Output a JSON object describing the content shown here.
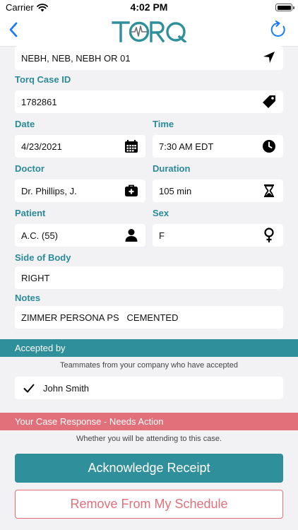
{
  "status_bar": {
    "carrier": "Carrier",
    "time": "4:02 PM"
  },
  "nav": {
    "logo_text": "TORQ"
  },
  "location": {
    "value": "NEBH, NEB, NEBH OR 01",
    "icon": "location-arrow-icon"
  },
  "case_id": {
    "label": "Torq Case ID",
    "value": "1782861",
    "icon": "tag-icon"
  },
  "date": {
    "label": "Date",
    "value": "4/23/2021",
    "icon": "calendar-icon"
  },
  "time": {
    "label": "Time",
    "value": "7:30 AM EDT",
    "icon": "clock-icon"
  },
  "doctor": {
    "label": "Doctor",
    "value": "Dr. Phillips, J.",
    "icon": "medical-kit-icon"
  },
  "duration": {
    "label": "Duration",
    "value": "105 min",
    "icon": "hourglass-icon"
  },
  "patient": {
    "label": "Patient",
    "value": "A.C. (55)",
    "icon": "person-icon"
  },
  "sex": {
    "label": "Sex",
    "value": "F",
    "icon": "female-icon"
  },
  "side_of_body": {
    "label": "Side of Body",
    "value": "RIGHT"
  },
  "notes": {
    "label": "Notes",
    "value": "ZIMMER PERSONA PS   CEMENTED"
  },
  "accepted": {
    "header": "Accepted by",
    "note": "Teammates from your company who have accepted",
    "people": [
      "John Smith"
    ]
  },
  "response": {
    "header": "Your Case Response - Needs Action",
    "note": "Whether you will be attending to this case.",
    "acknowledge_label": "Acknowledge Receipt",
    "remove_label": "Remove From My Schedule"
  },
  "colors": {
    "teal": "#2f8f9b",
    "label_teal": "#2b8a98",
    "coral": "#e2707a",
    "ios_blue": "#1a7cf5"
  }
}
